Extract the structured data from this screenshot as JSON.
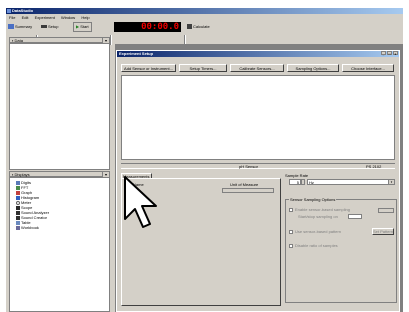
{
  "app": {
    "title": "DataStudio"
  },
  "menu": [
    "File",
    "Edit",
    "Experiment",
    "Window",
    "Help"
  ],
  "toolbar": {
    "summary_label": "Summary",
    "setup_label": "Setup",
    "start_label": "Start",
    "timer_value": "00:00.0",
    "calculate_label": "Calculate"
  },
  "data_panel": {
    "title": "Data"
  },
  "displays_panel": {
    "title": "Displays",
    "items": [
      "Digits",
      "FFT",
      "Graph",
      "Histogram",
      "Meter",
      "Scope",
      "Sound Analyzer",
      "Sound Creator",
      "Table",
      "Workbook"
    ]
  },
  "setup_window": {
    "title": "Experiment Setup",
    "buttons": [
      "Add Sensor or Instrument...",
      "Setup Timers...",
      "Calibrate Sensors...",
      "Sampling Options...",
      "Choose Interface..."
    ],
    "sensor_label": "pH Sensor",
    "interface_label": "PS 2102",
    "tab_label": "Measurements",
    "col_visible": "Vis",
    "col_name": "Name",
    "col_unit": "Unit of Measure",
    "row_check": "✓",
    "sample_rate": {
      "label": "Sample Rate",
      "value": "5",
      "unit": "Hz"
    },
    "sensor_sampling": {
      "label": "Sensor Sampling Options",
      "opt1": "Enable sensor-based sampling",
      "opt2": "Start/stop sampling on",
      "opt3": "Use sensor-based pattern",
      "opt3_button": "Set Pattern",
      "opt4": "Disable ratio of samples"
    }
  }
}
